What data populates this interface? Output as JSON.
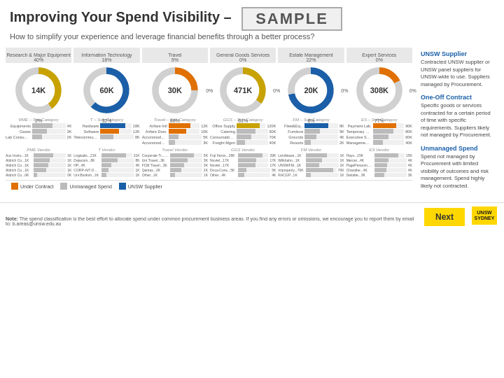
{
  "header": {
    "title": "Improving Your Spend Visibility –",
    "sample": "SAMPLE",
    "subtitle": "How to simplify your experience and leverage financial benefits through a better process?"
  },
  "categories": [
    {
      "label": "Research & Major\nEquipment",
      "value": "14K",
      "pct_top": "40%",
      "pct_bottom": "2%",
      "pct_left": "",
      "pct_right": "",
      "donut_pct": 40,
      "color": "gold"
    },
    {
      "label": "Information\nTechnology",
      "value": "60K",
      "pct_top": "18%",
      "pct_bottom": "32%",
      "pct_left": "",
      "pct_right": "",
      "donut_pct": 62,
      "color": "blue"
    },
    {
      "label": "Travel",
      "value": "30K",
      "pct_top": "9%",
      "pct_bottom": "86%",
      "pct_left": "",
      "pct_right": "",
      "donut_pct": 25,
      "color": "orange"
    },
    {
      "label": "General Goods\nServices",
      "value": "471K",
      "pct_top": "0%",
      "pct_bottom": "61%",
      "pct_left": "0%",
      "pct_right": "0%",
      "donut_pct": 35,
      "color": "gold"
    },
    {
      "label": "Estate\nManagement",
      "value": "20K",
      "pct_top": "22%",
      "pct_bottom": "6%",
      "pct_left": "",
      "pct_right": "0%",
      "donut_pct": 72,
      "color": "blue"
    },
    {
      "label": "Expert\nServices",
      "value": "308K",
      "pct_top": "0%",
      "pct_bottom": "77%",
      "pct_left": "",
      "pct_right": "0%",
      "donut_pct": 18,
      "color": "orange"
    }
  ],
  "subcat_headers": [
    "RME – Sub-Category",
    "T – Sub-Category",
    "Travel – Sub-Category",
    "GGS – Sub-Category",
    "FM – Sub-Category",
    "ES – Sub-Category"
  ],
  "subcats": [
    [
      {
        "label": "Equipments",
        "value": "4K",
        "pct": 60,
        "type": "gray"
      },
      {
        "label": "Gases",
        "value": "3K",
        "pct": 45,
        "type": "gray"
      },
      {
        "label": "Lab Consuma...",
        "value": "2K",
        "pct": 30,
        "type": "gray"
      }
    ],
    [
      {
        "label": "Hardware",
        "value": "18K",
        "pct": 80,
        "type": "blue"
      },
      {
        "label": "Software",
        "value": "12K",
        "pct": 60,
        "type": "orange"
      },
      {
        "label": "Telecommuni...",
        "value": "8K",
        "pct": 40,
        "type": "gray"
      }
    ],
    [
      {
        "label": "Airfare Intl",
        "value": "12K",
        "pct": 70,
        "type": "orange"
      },
      {
        "label": "Airfare Dom.",
        "value": "10K",
        "pct": 58,
        "type": "orange"
      },
      {
        "label": "Accommodat...",
        "value": "5K",
        "pct": 30,
        "type": "gray"
      },
      {
        "label": "Accommodat...",
        "value": "3K",
        "pct": 20,
        "type": "gray"
      }
    ],
    [
      {
        "label": "Office Supply",
        "value": "120K",
        "pct": 80,
        "type": "gold"
      },
      {
        "label": "Catering",
        "value": "90K",
        "pct": 60,
        "type": "gray"
      },
      {
        "label": "Consumable C",
        "value": "70K",
        "pct": 48,
        "type": "gray"
      },
      {
        "label": "Freight Mgmt",
        "value": "40K",
        "pct": 26,
        "type": "gray"
      }
    ],
    [
      {
        "label": "Fleet&Eq...",
        "value": "8K",
        "pct": 70,
        "type": "blue"
      },
      {
        "label": "Furniture",
        "value": "5K",
        "pct": 45,
        "type": "gray"
      },
      {
        "label": "Grounds",
        "value": "4K",
        "pct": 35,
        "type": "gray"
      },
      {
        "label": "Resorts",
        "value": "2K",
        "pct": 18,
        "type": "gray"
      }
    ],
    [
      {
        "label": "Payment Lab.",
        "value": "90K",
        "pct": 75,
        "type": "orange"
      },
      {
        "label": "Temporary Lab",
        "value": "80K",
        "pct": 65,
        "type": "gray"
      },
      {
        "label": "Executive Sea...",
        "value": "60K",
        "pct": 50,
        "type": "gray"
      },
      {
        "label": "Management...",
        "value": "40K",
        "pct": 32,
        "type": "gray"
      }
    ]
  ],
  "vendor_headers": [
    "PME Vendor",
    "T Vendor",
    "Travel Vendor",
    "GGS Vendor",
    "FM Vendor",
    "ES Vendor"
  ],
  "vendors": [
    [
      {
        "label": "Aus Instru...1K",
        "value": "1K",
        "pct": 60
      },
      {
        "label": "Aldrich Co...1K",
        "value": "1K",
        "pct": 50
      },
      {
        "label": "Aldrich Co...1K",
        "value": "1K",
        "pct": 45
      },
      {
        "label": "Aldrich Co...1K",
        "value": "1K",
        "pct": 40
      },
      {
        "label": "Aldrich Co...0K",
        "value": "0K",
        "pct": 10
      }
    ],
    [
      {
        "label": "Logicalis...21K",
        "value": "21K",
        "pct": 80
      },
      {
        "label": "Datacom...8K",
        "value": "8K",
        "pct": 50
      },
      {
        "label": "HP...4K",
        "value": "4K",
        "pct": 30
      },
      {
        "label": "CORP-AIT-OM...1K",
        "value": "1K",
        "pct": 20
      },
      {
        "label": "Uni Booksh...1K",
        "value": "1K",
        "pct": 15
      }
    ],
    [
      {
        "label": "Corporate Tr...5K",
        "value": "5K",
        "pct": 75
      },
      {
        "label": "Uni Travel...3K",
        "value": "3K",
        "pct": 55
      },
      {
        "label": "FCM Travel...3K",
        "value": "3K",
        "pct": 45
      },
      {
        "label": "Qantas...2K",
        "value": "2K",
        "pct": 35
      },
      {
        "label": "Other...1K",
        "value": "1K",
        "pct": 15
      }
    ],
    [
      {
        "label": "Fuji Xerox...29K",
        "value": "29K",
        "pct": 80
      },
      {
        "label": "Novtel...17K",
        "value": "17K",
        "pct": 60
      },
      {
        "label": "Novtel...17K",
        "value": "17K",
        "pct": 58
      },
      {
        "label": "Doca-Cons...5K",
        "value": "5K",
        "pct": 25
      },
      {
        "label": "Other...4K",
        "value": "4K",
        "pct": 20
      }
    ],
    [
      {
        "label": "Lendlease...1K",
        "value": "1K",
        "pct": 65
      },
      {
        "label": "Wilkhahn...1K",
        "value": "1K",
        "pct": 50
      },
      {
        "label": "UNSWFM...1K",
        "value": "1K",
        "pct": 40
      },
      {
        "label": "Improperly...70K",
        "value": "70K",
        "pct": 90
      },
      {
        "label": "RACGP...1K",
        "value": "1K",
        "pct": 15
      }
    ],
    [
      {
        "label": "Hays...15K",
        "value": "15K",
        "pct": 80
      },
      {
        "label": "Mercer...4K",
        "value": "4K",
        "pct": 45
      },
      {
        "label": "PagePersonn...4K",
        "value": "4K",
        "pct": 40
      },
      {
        "label": "Chandler...4K",
        "value": "4K",
        "pct": 38
      },
      {
        "label": "Deloitte...3K",
        "value": "3K",
        "pct": 32
      }
    ]
  ],
  "legend": {
    "items": [
      {
        "label": "Under Contract",
        "color": "orange"
      },
      {
        "label": "Unmanaged Spend",
        "color": "gray"
      },
      {
        "label": "UNSW Supplier",
        "color": "blue"
      }
    ]
  },
  "sidebar": {
    "blocks": [
      {
        "title": "UNSW Supplier",
        "text": "Contracted UNSW supplier or UNSW panel suppliers for UNSW-wide to use. Suppliers managed by Procurement."
      },
      {
        "title": "One-Off Contract",
        "text": "Specific goods or services contracted for a certain period of time with specific requirements. Suppliers likely not managed by Procurement."
      },
      {
        "title": "Unmanaged Spend",
        "text": "Spend not managed by Procurement with limited visibility of outcomes and risk management. Spend highly likely not contracted."
      }
    ]
  },
  "footer": {
    "note_strong": "Note:",
    "note_text": " The spend classification is the best effort to allocate spend under common procurement business areas.  If you find any errors or omissions, we encourage you to report them by email to: b.areas@unsw.edu.au",
    "next_label": "Next",
    "logo_text": "UNSW\nSYDNEY"
  }
}
